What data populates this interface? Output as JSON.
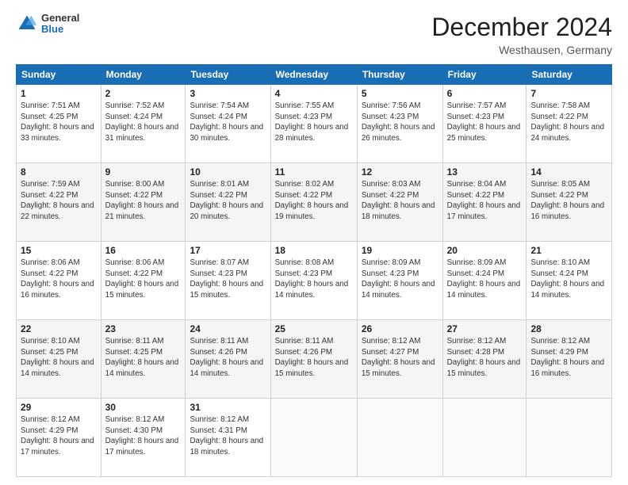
{
  "header": {
    "logo_general": "General",
    "logo_blue": "Blue",
    "main_title": "December 2024",
    "subtitle": "Westhausen, Germany"
  },
  "calendar": {
    "days_of_week": [
      "Sunday",
      "Monday",
      "Tuesday",
      "Wednesday",
      "Thursday",
      "Friday",
      "Saturday"
    ],
    "weeks": [
      [
        null,
        {
          "num": "2",
          "sunrise": "7:52 AM",
          "sunset": "4:24 PM",
          "daylight": "8 hours and 31 minutes."
        },
        {
          "num": "3",
          "sunrise": "7:54 AM",
          "sunset": "4:24 PM",
          "daylight": "8 hours and 30 minutes."
        },
        {
          "num": "4",
          "sunrise": "7:55 AM",
          "sunset": "4:23 PM",
          "daylight": "8 hours and 28 minutes."
        },
        {
          "num": "5",
          "sunrise": "7:56 AM",
          "sunset": "4:23 PM",
          "daylight": "8 hours and 26 minutes."
        },
        {
          "num": "6",
          "sunrise": "7:57 AM",
          "sunset": "4:23 PM",
          "daylight": "8 hours and 25 minutes."
        },
        {
          "num": "7",
          "sunrise": "7:58 AM",
          "sunset": "4:22 PM",
          "daylight": "8 hours and 24 minutes."
        }
      ],
      [
        {
          "num": "1",
          "sunrise": "7:51 AM",
          "sunset": "4:25 PM",
          "daylight": "8 hours and 33 minutes."
        },
        {
          "num": "9",
          "sunrise": "8:00 AM",
          "sunset": "4:22 PM",
          "daylight": "8 hours and 21 minutes."
        },
        {
          "num": "10",
          "sunrise": "8:01 AM",
          "sunset": "4:22 PM",
          "daylight": "8 hours and 20 minutes."
        },
        {
          "num": "11",
          "sunrise": "8:02 AM",
          "sunset": "4:22 PM",
          "daylight": "8 hours and 19 minutes."
        },
        {
          "num": "12",
          "sunrise": "8:03 AM",
          "sunset": "4:22 PM",
          "daylight": "8 hours and 18 minutes."
        },
        {
          "num": "13",
          "sunrise": "8:04 AM",
          "sunset": "4:22 PM",
          "daylight": "8 hours and 17 minutes."
        },
        {
          "num": "14",
          "sunrise": "8:05 AM",
          "sunset": "4:22 PM",
          "daylight": "8 hours and 16 minutes."
        }
      ],
      [
        {
          "num": "8",
          "sunrise": "7:59 AM",
          "sunset": "4:22 PM",
          "daylight": "8 hours and 22 minutes."
        },
        {
          "num": "16",
          "sunrise": "8:06 AM",
          "sunset": "4:22 PM",
          "daylight": "8 hours and 15 minutes."
        },
        {
          "num": "17",
          "sunrise": "8:07 AM",
          "sunset": "4:23 PM",
          "daylight": "8 hours and 15 minutes."
        },
        {
          "num": "18",
          "sunrise": "8:08 AM",
          "sunset": "4:23 PM",
          "daylight": "8 hours and 14 minutes."
        },
        {
          "num": "19",
          "sunrise": "8:09 AM",
          "sunset": "4:23 PM",
          "daylight": "8 hours and 14 minutes."
        },
        {
          "num": "20",
          "sunrise": "8:09 AM",
          "sunset": "4:24 PM",
          "daylight": "8 hours and 14 minutes."
        },
        {
          "num": "21",
          "sunrise": "8:10 AM",
          "sunset": "4:24 PM",
          "daylight": "8 hours and 14 minutes."
        }
      ],
      [
        {
          "num": "15",
          "sunrise": "8:06 AM",
          "sunset": "4:22 PM",
          "daylight": "8 hours and 16 minutes."
        },
        {
          "num": "23",
          "sunrise": "8:11 AM",
          "sunset": "4:25 PM",
          "daylight": "8 hours and 14 minutes."
        },
        {
          "num": "24",
          "sunrise": "8:11 AM",
          "sunset": "4:26 PM",
          "daylight": "8 hours and 14 minutes."
        },
        {
          "num": "25",
          "sunrise": "8:11 AM",
          "sunset": "4:26 PM",
          "daylight": "8 hours and 15 minutes."
        },
        {
          "num": "26",
          "sunrise": "8:12 AM",
          "sunset": "4:27 PM",
          "daylight": "8 hours and 15 minutes."
        },
        {
          "num": "27",
          "sunrise": "8:12 AM",
          "sunset": "4:28 PM",
          "daylight": "8 hours and 15 minutes."
        },
        {
          "num": "28",
          "sunrise": "8:12 AM",
          "sunset": "4:29 PM",
          "daylight": "8 hours and 16 minutes."
        }
      ],
      [
        {
          "num": "22",
          "sunrise": "8:10 AM",
          "sunset": "4:25 PM",
          "daylight": "8 hours and 14 minutes."
        },
        {
          "num": "30",
          "sunrise": "8:12 AM",
          "sunset": "4:30 PM",
          "daylight": "8 hours and 17 minutes."
        },
        {
          "num": "31",
          "sunrise": "8:12 AM",
          "sunset": "4:31 PM",
          "daylight": "8 hours and 18 minutes."
        },
        null,
        null,
        null,
        null
      ],
      [
        {
          "num": "29",
          "sunrise": "8:12 AM",
          "sunset": "4:29 PM",
          "daylight": "8 hours and 17 minutes."
        },
        null,
        null,
        null,
        null,
        null,
        null
      ]
    ]
  }
}
